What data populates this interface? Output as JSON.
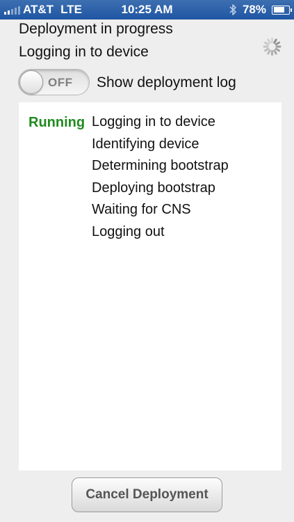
{
  "status_bar": {
    "carrier": "AT&T",
    "network": "LTE",
    "time": "10:25 AM",
    "battery_percent_label": "78%",
    "battery_level": 0.78,
    "signal_bars_filled": 2,
    "icons": [
      "signal-icon",
      "bluetooth-icon",
      "battery-icon"
    ]
  },
  "header": {
    "title": "Deployment in progress",
    "subtitle": "Logging in to device"
  },
  "toggle": {
    "state_label": "OFF",
    "label": "Show deployment log"
  },
  "log": {
    "status": "Running",
    "status_color": "#1f8a1f",
    "steps": [
      "Logging in to device",
      "Identifying device",
      "Determining bootstrap",
      "Deploying bootstrap",
      "Waiting for CNS",
      "Logging out"
    ]
  },
  "footer": {
    "cancel_label": "Cancel Deployment"
  }
}
